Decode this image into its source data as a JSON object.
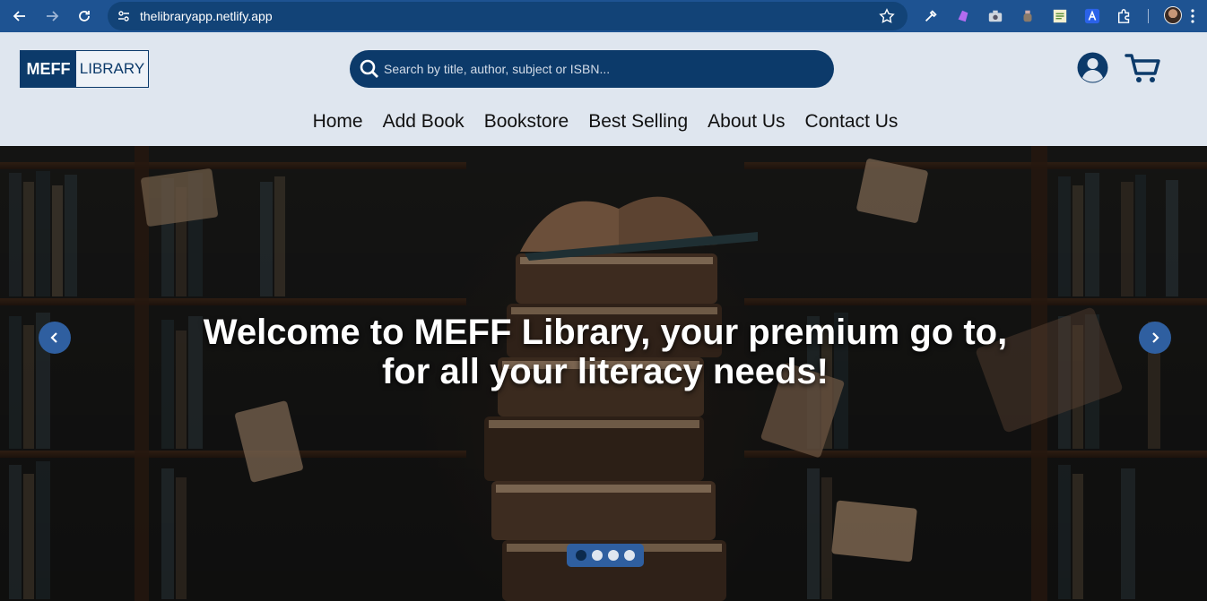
{
  "browser": {
    "url": "thelibraryapp.netlify.app"
  },
  "header": {
    "logo_primary": "MEFF",
    "logo_secondary": "LIBRARY",
    "search_placeholder": "Search by title, author, subject or ISBN...",
    "nav": [
      "Home",
      "Add Book",
      "Bookstore",
      "Best Selling",
      "About Us",
      "Contact Us"
    ]
  },
  "hero": {
    "title": "Welcome to MEFF Library, your premium go to, for all your literacy needs!",
    "slides": 4,
    "active_slide": 1
  },
  "colors": {
    "brand": "#0c3a6a",
    "chrome": "#1e5392",
    "accent": "#2f5fa0",
    "header_bg": "#dfe6ef"
  }
}
